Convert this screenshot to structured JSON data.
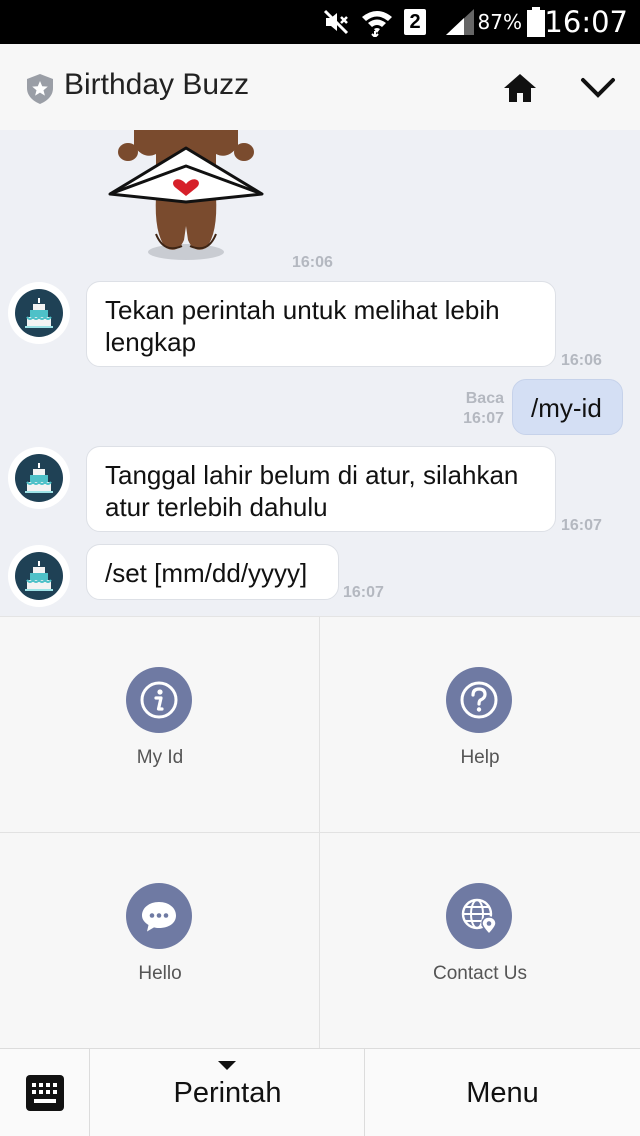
{
  "status_bar": {
    "time": "16:07",
    "battery_percent": "87%",
    "sim_slot": "2",
    "icons": [
      "mute-icon",
      "wifi-icon",
      "sim-icon",
      "signal-icon",
      "battery-icon"
    ]
  },
  "header": {
    "title": "Birthday Buzz",
    "icons": [
      "shield-icon",
      "home-icon",
      "chevron-down-icon"
    ]
  },
  "chat": {
    "sticker": {
      "name": "bear-letter-sticker",
      "time": "16:06"
    },
    "messages": [
      {
        "from": "bot",
        "text": "Tekan perintah untuk melihat lebih lengkap",
        "time": "16:06"
      },
      {
        "from": "me",
        "text": "/my-id",
        "status": "Baca",
        "time": "16:07"
      },
      {
        "from": "bot",
        "text": "Tanggal lahir belum di atur, silahkan atur terlebih dahulu",
        "time": "16:07"
      },
      {
        "from": "bot",
        "text": "/set [mm/dd/yyyy]",
        "time": "16:07"
      }
    ]
  },
  "commands": [
    {
      "label": "My Id",
      "icon": "info-icon"
    },
    {
      "label": "Help",
      "icon": "question-icon"
    },
    {
      "label": "Hello",
      "icon": "chat-bubble-icon"
    },
    {
      "label": "Contact Us",
      "icon": "globe-pin-icon"
    }
  ],
  "bottom_bar": {
    "keyboard_icon": "keyboard-icon",
    "perintah_label": "Perintah",
    "menu_label": "Menu"
  },
  "colors": {
    "chat_background": "#eef0f5",
    "my_bubble": "#d4dff4",
    "command_icon": "#6f7aa3",
    "avatar": "#1f4155"
  }
}
